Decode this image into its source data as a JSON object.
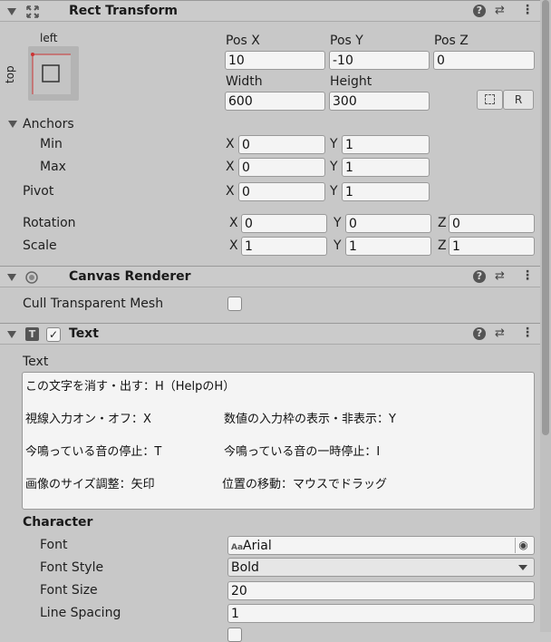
{
  "rect_transform": {
    "title": "Rect Transform",
    "anchor_preset": {
      "horizontal": "left",
      "vertical": "top"
    },
    "pos_x": {
      "label": "Pos X",
      "value": "10"
    },
    "pos_y": {
      "label": "Pos Y",
      "value": "-10"
    },
    "pos_z": {
      "label": "Pos Z",
      "value": "0"
    },
    "width": {
      "label": "Width",
      "value": "600"
    },
    "height": {
      "label": "Height",
      "value": "300"
    },
    "raw_edit_label": "R",
    "anchors": {
      "label": "Anchors",
      "min": {
        "label": "Min",
        "x": "0",
        "y": "1"
      },
      "max": {
        "label": "Max",
        "x": "0",
        "y": "1"
      }
    },
    "pivot": {
      "label": "Pivot",
      "x": "0",
      "y": "1"
    },
    "rotation": {
      "label": "Rotation",
      "x": "0",
      "y": "0",
      "z": "0"
    },
    "scale": {
      "label": "Scale",
      "x": "1",
      "y": "1",
      "z": "1"
    },
    "axis_labels": {
      "x": "X",
      "y": "Y",
      "z": "Z"
    }
  },
  "canvas_renderer": {
    "title": "Canvas Renderer",
    "cull_label": "Cull Transparent Mesh",
    "cull_checked": false
  },
  "text_component": {
    "title": "Text",
    "enabled": true,
    "text_label": "Text",
    "text_lines": [
      {
        "left": "この文字を消す・出す：H（HelpのH）",
        "right": ""
      },
      {
        "left": "視線入力オン・オフ：X",
        "right": "数値の入力枠の表示・非表示：Y"
      },
      {
        "left": "今鳴っている音の停止：T",
        "right": "今鳴っている音の一時停止：I"
      },
      {
        "left": "画像のサイズ調整：矢印",
        "right": "位置の移動：マウスでドラッグ"
      }
    ],
    "character": {
      "label": "Character",
      "font": {
        "label": "Font",
        "icon_text": "Aa",
        "value": "Arial"
      },
      "font_style": {
        "label": "Font Style",
        "value": "Bold"
      },
      "font_size": {
        "label": "Font Size",
        "value": "20"
      },
      "line_spacing": {
        "label": "Line Spacing",
        "value": "1"
      }
    }
  },
  "icons": {
    "help": "help-icon",
    "presets": "presets-icon",
    "menu": "kebab-menu-icon"
  },
  "colors": {
    "panel_bg": "#c8c8c8",
    "field_bg": "#f4f4f4",
    "anchor_red": "#cc3333"
  }
}
